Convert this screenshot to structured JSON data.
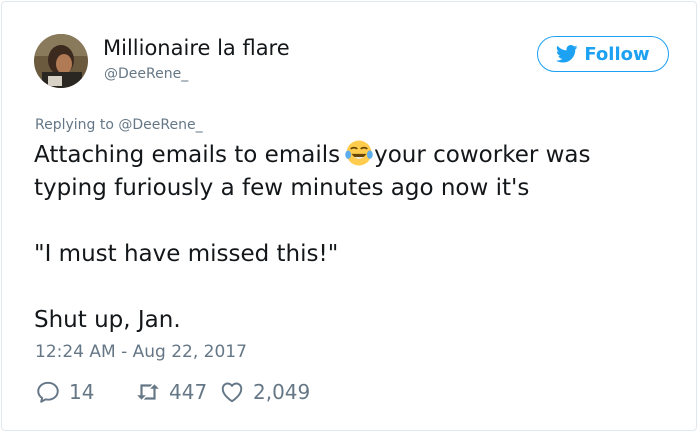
{
  "author": {
    "display_name": "Millionaire la flare",
    "handle": "@DeeRene_"
  },
  "follow_button": {
    "label": "Follow",
    "icon": "twitter-bird-icon",
    "color": "#1da1f2"
  },
  "reply": {
    "prefix": "Replying to",
    "to_handle": "@DeeRene_"
  },
  "tweet": {
    "line1_before_emoji": "Attaching emails to emails",
    "emoji": "tears-of-joy-emoji",
    "line1_after_emoji": "your coworker was",
    "line2": "typing furiously a few minutes ago now it's",
    "line3": "\"I must have missed this!\"",
    "line4": "Shut up, Jan."
  },
  "timestamp": "12:24 AM - Aug 22, 2017",
  "stats": {
    "replies": "14",
    "retweets": "447",
    "likes": "2,049"
  },
  "colors": {
    "text": "#14171a",
    "secondary": "#657786",
    "border": "#e1e8ed"
  }
}
